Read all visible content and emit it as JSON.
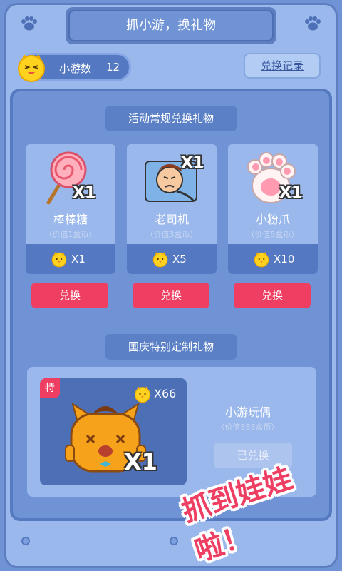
{
  "header": {
    "title": "抓小游，换礼物"
  },
  "user": {
    "coin_label": "小游数",
    "coin_count": "12"
  },
  "toolbar": {
    "history_label": "兑换记录"
  },
  "regular_section": {
    "label": "活动常规兑换礼物",
    "gifts": [
      {
        "name": "棒棒糖",
        "value_note": "（价值1盒币）",
        "price": "X1",
        "badge": "X1",
        "redeem_label": "兑换"
      },
      {
        "name": "老司机",
        "value_note": "（价值3盒币）",
        "price": "X5",
        "badge": "X1",
        "redeem_label": "兑换"
      },
      {
        "name": "小粉爪",
        "value_note": "（价值5盒币）",
        "price": "X10",
        "badge": "X1",
        "redeem_label": "兑换"
      }
    ]
  },
  "special_section": {
    "label": "国庆特别定制礼物",
    "tag": "特",
    "price": "X66",
    "badge": "X1",
    "name": "小游玩偶",
    "value_note": "（价值888盒币）",
    "status_label": "已兑换"
  },
  "banner": {
    "text": "抓到娃娃啦！"
  },
  "colors": {
    "accent": "#ee3f63",
    "panel": "#6f93d4",
    "frame": "#9ab8ec"
  }
}
